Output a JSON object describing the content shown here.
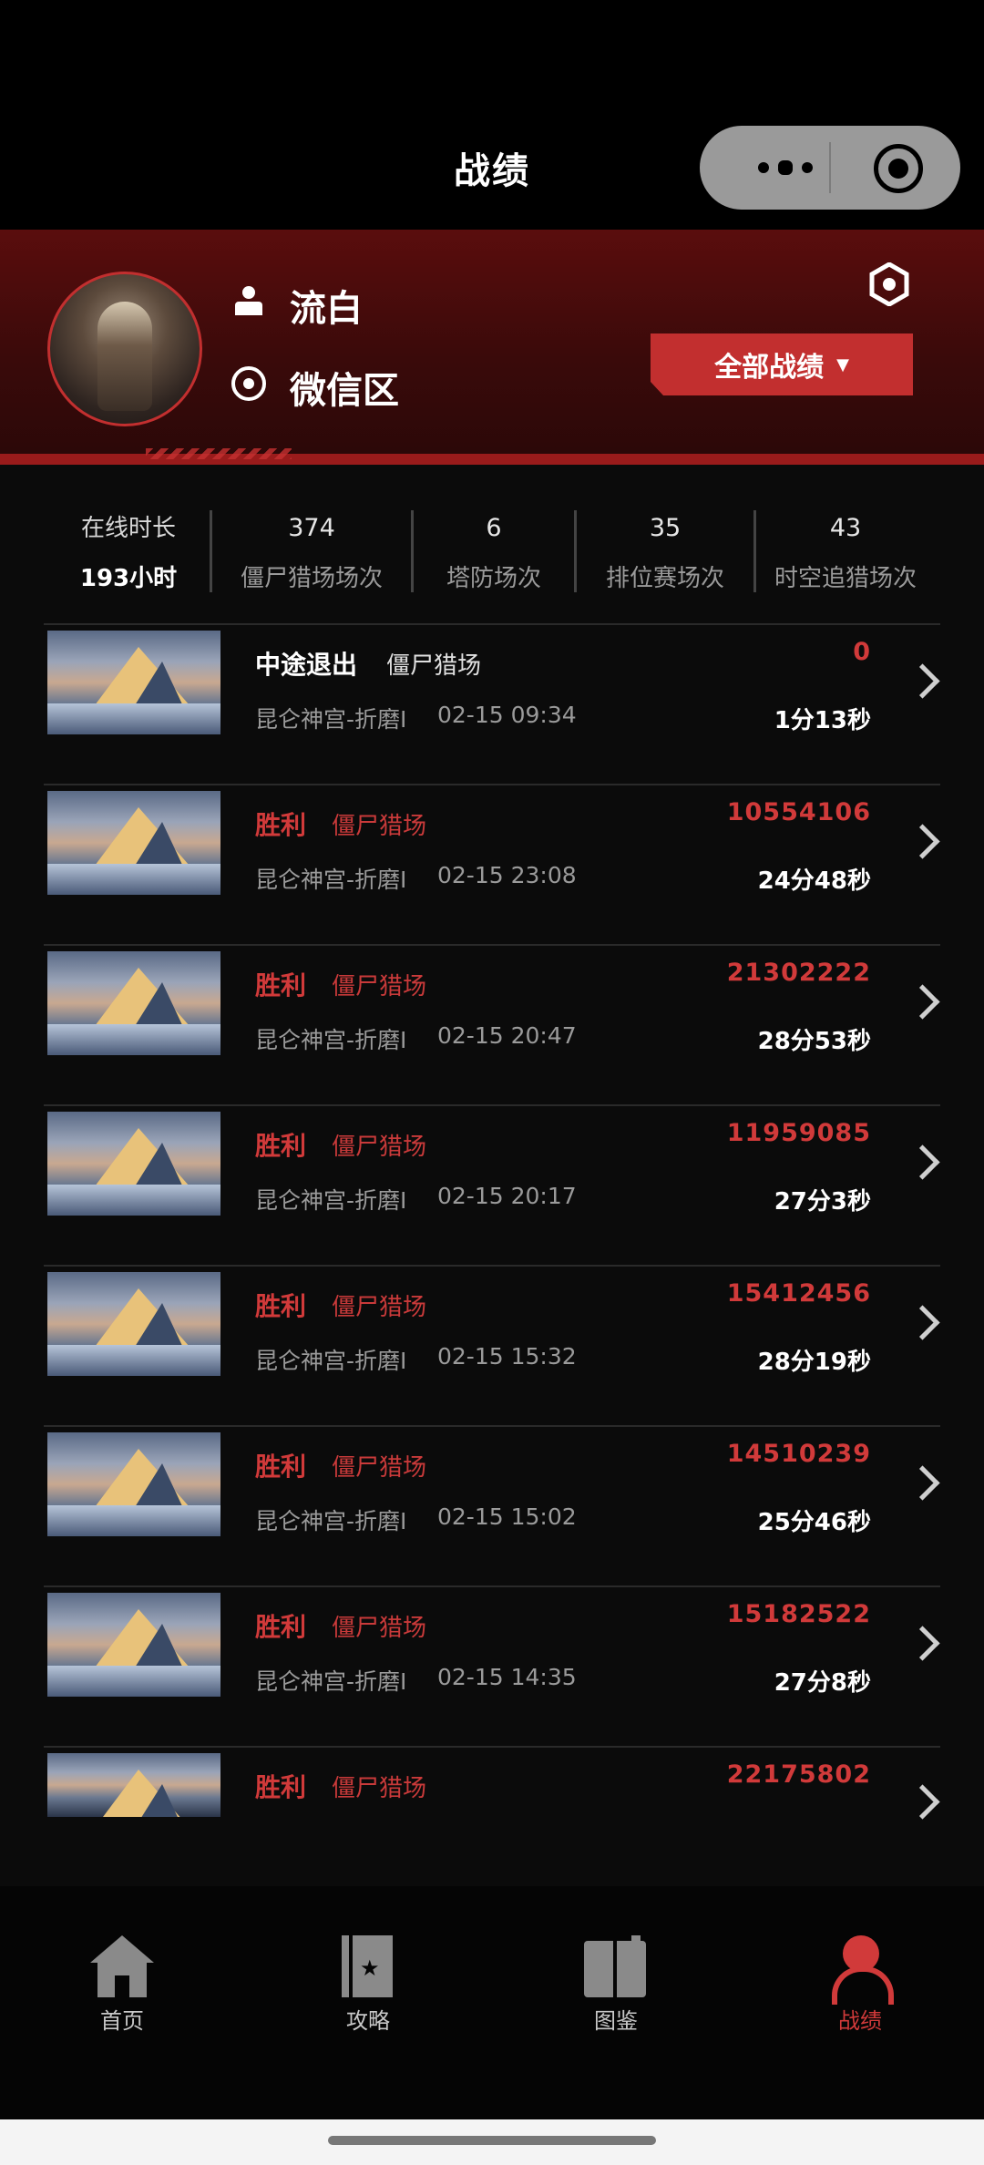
{
  "nav": {
    "title": "战绩"
  },
  "profile": {
    "username": "流白",
    "region": "微信区",
    "filter_label": "全部战绩",
    "filter_caret": "▼"
  },
  "stats": [
    {
      "value": "",
      "label": "在线时长",
      "sub": "193小时"
    },
    {
      "value": "374",
      "label": "僵尸猎场场次"
    },
    {
      "value": "6",
      "label": "塔防场次"
    },
    {
      "value": "35",
      "label": "排位赛场次"
    },
    {
      "value": "43",
      "label": "时空追猎场次"
    }
  ],
  "records": [
    {
      "status": "中途退出",
      "mode": "僵尸猎场",
      "map": "昆仑神宫-折磨I",
      "time": "02-15 09:34",
      "score": "0",
      "duration": "1分13秒",
      "win": false
    },
    {
      "status": "胜利",
      "mode": "僵尸猎场",
      "map": "昆仑神宫-折磨I",
      "time": "02-15 23:08",
      "score": "10554106",
      "duration": "24分48秒",
      "win": true
    },
    {
      "status": "胜利",
      "mode": "僵尸猎场",
      "map": "昆仑神宫-折磨I",
      "time": "02-15 20:47",
      "score": "21302222",
      "duration": "28分53秒",
      "win": true
    },
    {
      "status": "胜利",
      "mode": "僵尸猎场",
      "map": "昆仑神宫-折磨I",
      "time": "02-15 20:17",
      "score": "11959085",
      "duration": "27分3秒",
      "win": true
    },
    {
      "status": "胜利",
      "mode": "僵尸猎场",
      "map": "昆仑神宫-折磨I",
      "time": "02-15 15:32",
      "score": "15412456",
      "duration": "28分19秒",
      "win": true
    },
    {
      "status": "胜利",
      "mode": "僵尸猎场",
      "map": "昆仑神宫-折磨I",
      "time": "02-15 15:02",
      "score": "14510239",
      "duration": "25分46秒",
      "win": true
    },
    {
      "status": "胜利",
      "mode": "僵尸猎场",
      "map": "昆仑神宫-折磨I",
      "time": "02-15 14:35",
      "score": "15182522",
      "duration": "27分8秒",
      "win": true
    },
    {
      "status": "胜利",
      "mode": "僵尸猎场",
      "score": "22175802",
      "win": true
    }
  ],
  "tabs": [
    {
      "label": "首页",
      "icon": "home-icon"
    },
    {
      "label": "攻略",
      "icon": "guide-book-icon"
    },
    {
      "label": "图鉴",
      "icon": "atlas-book-icon"
    },
    {
      "label": "战绩",
      "icon": "record-user-icon",
      "active": true
    }
  ],
  "colors": {
    "accent": "#d13a3a",
    "header": "#3a0a0a",
    "background": "#0b0b0b"
  }
}
